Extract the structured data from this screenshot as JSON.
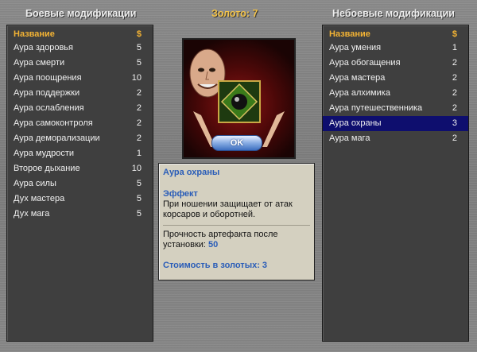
{
  "left": {
    "heading": "Боевые модификации",
    "col_name": "Название",
    "col_price": "$",
    "items": [
      {
        "name": "Аура здоровья",
        "price": "5"
      },
      {
        "name": "Аура смерти",
        "price": "5"
      },
      {
        "name": "Аура поощрения",
        "price": "10"
      },
      {
        "name": "Аура поддержки",
        "price": "2"
      },
      {
        "name": "Аура ослабления",
        "price": "2"
      },
      {
        "name": "Аура самоконтроля",
        "price": "2"
      },
      {
        "name": "Аура деморализации",
        "price": "2"
      },
      {
        "name": "Аура мудрости",
        "price": "1"
      },
      {
        "name": "Второе дыхание",
        "price": "10"
      },
      {
        "name": "Аура силы",
        "price": "5"
      },
      {
        "name": "Дух мастера",
        "price": "5"
      },
      {
        "name": "Дух мага",
        "price": "5"
      }
    ]
  },
  "gold": {
    "label": "Золото: 7"
  },
  "right": {
    "heading": "Небоевые модификации",
    "col_name": "Название",
    "col_price": "$",
    "selected_index": 5,
    "items": [
      {
        "name": "Аура умения",
        "price": "1"
      },
      {
        "name": "Аура обогащения",
        "price": "2"
      },
      {
        "name": "Аура мастера",
        "price": "2"
      },
      {
        "name": "Аура алхимика",
        "price": "2"
      },
      {
        "name": "Аура путешественника",
        "price": "2"
      },
      {
        "name": "Аура охраны",
        "price": "3"
      },
      {
        "name": "Аура мага",
        "price": "2"
      }
    ]
  },
  "center": {
    "ok_label": "OK",
    "info": {
      "title": "Аура охраны",
      "effect_label": "Эффект",
      "effect_text": "При ношении защищает от атак корсаров и оборотней.",
      "durability_text": "Прочность артефакта после установки: ",
      "durability_value": "50",
      "cost_text": "Стоимость в золотых: 3"
    }
  }
}
